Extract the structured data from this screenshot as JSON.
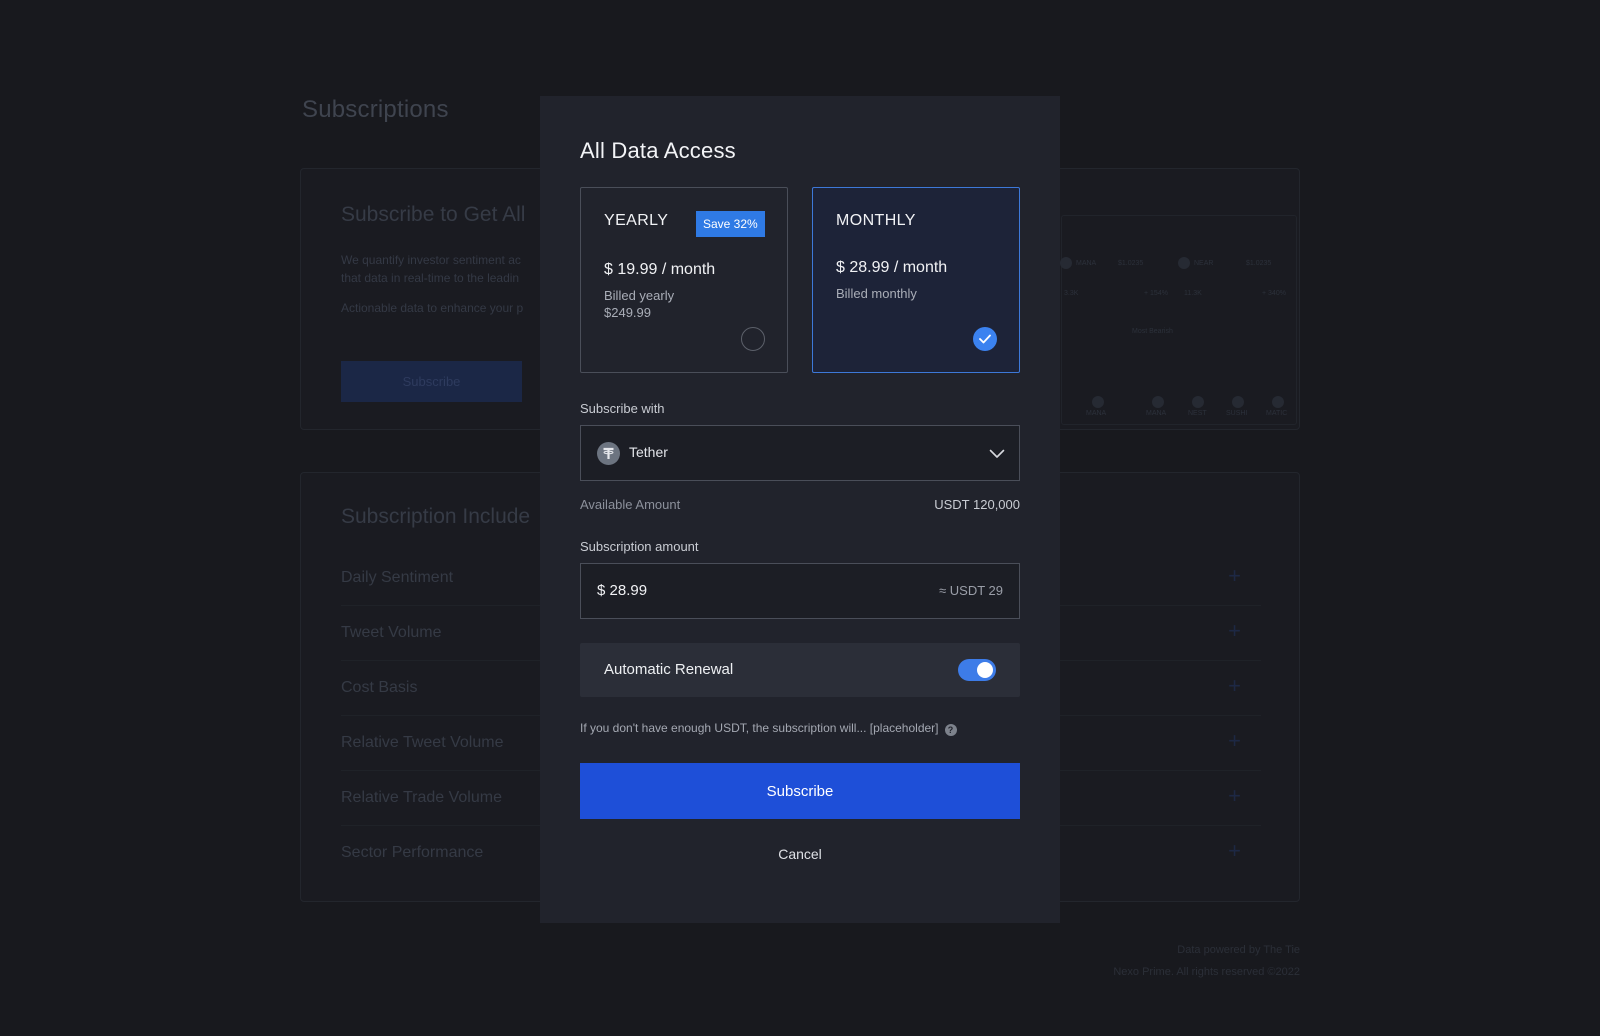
{
  "background": {
    "page_title": "Subscriptions",
    "hero": {
      "title": "Subscribe to Get All",
      "desc_line1": "We quantify investor sentiment ac",
      "desc_line2": "that data in real-time to the leadin",
      "desc_line3": "Actionable data to enhance your p",
      "button": "Subscribe"
    },
    "preview": {
      "coin1": "MANA",
      "coin2": "NEAR",
      "val1": "$1.0235",
      "val2": "$1.0235",
      "stat1": "3.3K",
      "stat2": "11.3K",
      "pct1": "+ 154%",
      "pct2": "+ 340%",
      "section": "Most Bearish",
      "tokens": [
        "MANA",
        "MANA",
        "NEST",
        "SUSHI",
        "MATIC"
      ]
    },
    "includes": {
      "title": "Subscription Include",
      "items": [
        "Daily Sentiment",
        "Tweet Volume",
        "Cost Basis",
        "Relative Tweet Volume",
        "Relative Trade Volume",
        "Sector Performance"
      ]
    },
    "footer": {
      "line1": "Data powered by The Tie",
      "line2": "Nexo Prime. All rights reserved ©2022"
    }
  },
  "modal": {
    "title": "All Data Access",
    "plans": {
      "yearly": {
        "name": "YEARLY",
        "badge": "Save 32%",
        "price": "$ 19.99 / month",
        "billed": "Billed yearly",
        "total": "$249.99",
        "selected": false
      },
      "monthly": {
        "name": "MONTHLY",
        "price": "$ 28.99 / month",
        "billed": "Billed monthly",
        "selected": true
      }
    },
    "subscribe_with": {
      "label": "Subscribe with",
      "selected": "Tether",
      "icon": "tether-icon"
    },
    "available": {
      "label": "Available Amount",
      "value": "USDT 120,000"
    },
    "subscription_amount": {
      "label": "Subscription amount",
      "value": "$ 28.99",
      "converted": "≈ USDT 29"
    },
    "auto_renewal": {
      "label": "Automatic Renewal",
      "enabled": true
    },
    "note": "If you don't have enough USDT, the subscription will... [placeholder]",
    "subscribe_button": "Subscribe",
    "cancel_button": "Cancel"
  },
  "colors": {
    "primary": "#1e4fd8",
    "accent": "#3b82f0",
    "modal_bg": "#21232c",
    "page_bg": "#18191e"
  }
}
